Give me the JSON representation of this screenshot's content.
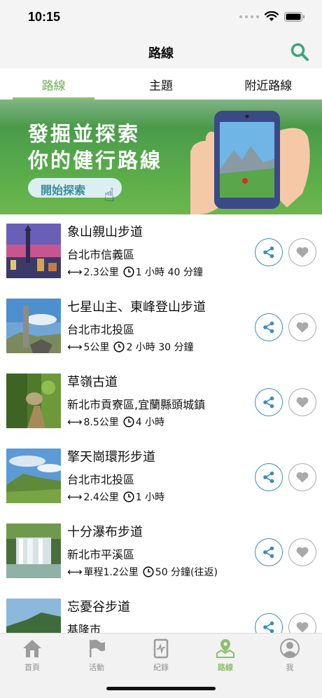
{
  "status": {
    "time": "10:15"
  },
  "header": {
    "title": "路線"
  },
  "tabs": [
    {
      "label": "路線",
      "active": true
    },
    {
      "label": "主題",
      "active": false
    },
    {
      "label": "附近路線",
      "active": false
    }
  ],
  "banner": {
    "line1": "發掘並探索",
    "line2": "你的健行路線",
    "button": "開始探索"
  },
  "trails": [
    {
      "name": "象山親山步道",
      "area": "台北市信義區",
      "distance": "2.3公里",
      "duration": "1 小時 40 分鐘"
    },
    {
      "name": "七星山主、東峰登山步道",
      "area": "台北市北投區",
      "distance": "5公里",
      "duration": "2 小時 30 分鐘"
    },
    {
      "name": "草嶺古道",
      "area": "新北市貢寮區,宜蘭縣頭城鎮",
      "distance": "8.5公里",
      "duration": "4 小時"
    },
    {
      "name": "擎天崗環形步道",
      "area": "台北市北投區",
      "distance": "2.4公里",
      "duration": "1 小時"
    },
    {
      "name": "十分瀑布步道",
      "area": "新北市平溪區",
      "distance": "單程1.2公里",
      "duration": "50 分鐘(往返)"
    },
    {
      "name": "忘憂谷步道",
      "area": "基隆市",
      "distance": "",
      "duration": ""
    }
  ],
  "tab_bar": [
    {
      "label": "首頁",
      "icon": "home-icon",
      "active": false
    },
    {
      "label": "活動",
      "icon": "flag-icon",
      "active": false
    },
    {
      "label": "紀錄",
      "icon": "record-icon",
      "active": false
    },
    {
      "label": "路線",
      "icon": "map-pin-icon",
      "active": true
    },
    {
      "label": "我",
      "icon": "user-icon",
      "active": false
    }
  ],
  "colors": {
    "accent_green": "#8dc06c",
    "share_blue": "#3c8bc0",
    "banner_green": "#4ea04b"
  }
}
